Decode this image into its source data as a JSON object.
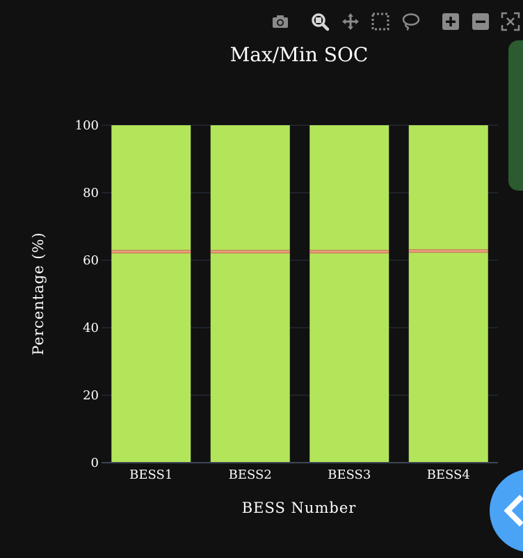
{
  "modebar": {
    "buttons": [
      {
        "name": "camera-icon"
      },
      {
        "name": "zoom-icon"
      },
      {
        "name": "pan-icon"
      },
      {
        "name": "box-select-icon"
      },
      {
        "name": "lasso-select-icon"
      },
      {
        "name": "zoom-in-icon"
      },
      {
        "name": "zoom-out-icon"
      },
      {
        "name": "autoscale-icon"
      }
    ]
  },
  "chart_data": {
    "type": "bar",
    "title": "Max/Min SOC",
    "xlabel": "BESS Number",
    "ylabel": "Percentage (%)",
    "categories": [
      "BESS1",
      "BESS2",
      "BESS3",
      "BESS4"
    ],
    "ylim": [
      0,
      100
    ],
    "yticks": [
      "0",
      "20",
      "40",
      "60",
      "80",
      "100"
    ],
    "grid": true,
    "series": [
      {
        "values": [
          62.2,
          62.2,
          62.2,
          62.4
        ],
        "color": "#b3e55a"
      },
      {
        "values": [
          0.8,
          0.8,
          0.8,
          0.8
        ],
        "color": "#e8a27c"
      },
      {
        "values": [
          37.0,
          37.0,
          37.0,
          36.8
        ],
        "color": "#b3e55a"
      }
    ],
    "separator_color": "#c0504d"
  },
  "colors": {
    "background": "#111111",
    "bar_fill": "#b3e55a",
    "accent_blue": "#4aa3f5",
    "side_tab": "#2b5b2e"
  }
}
